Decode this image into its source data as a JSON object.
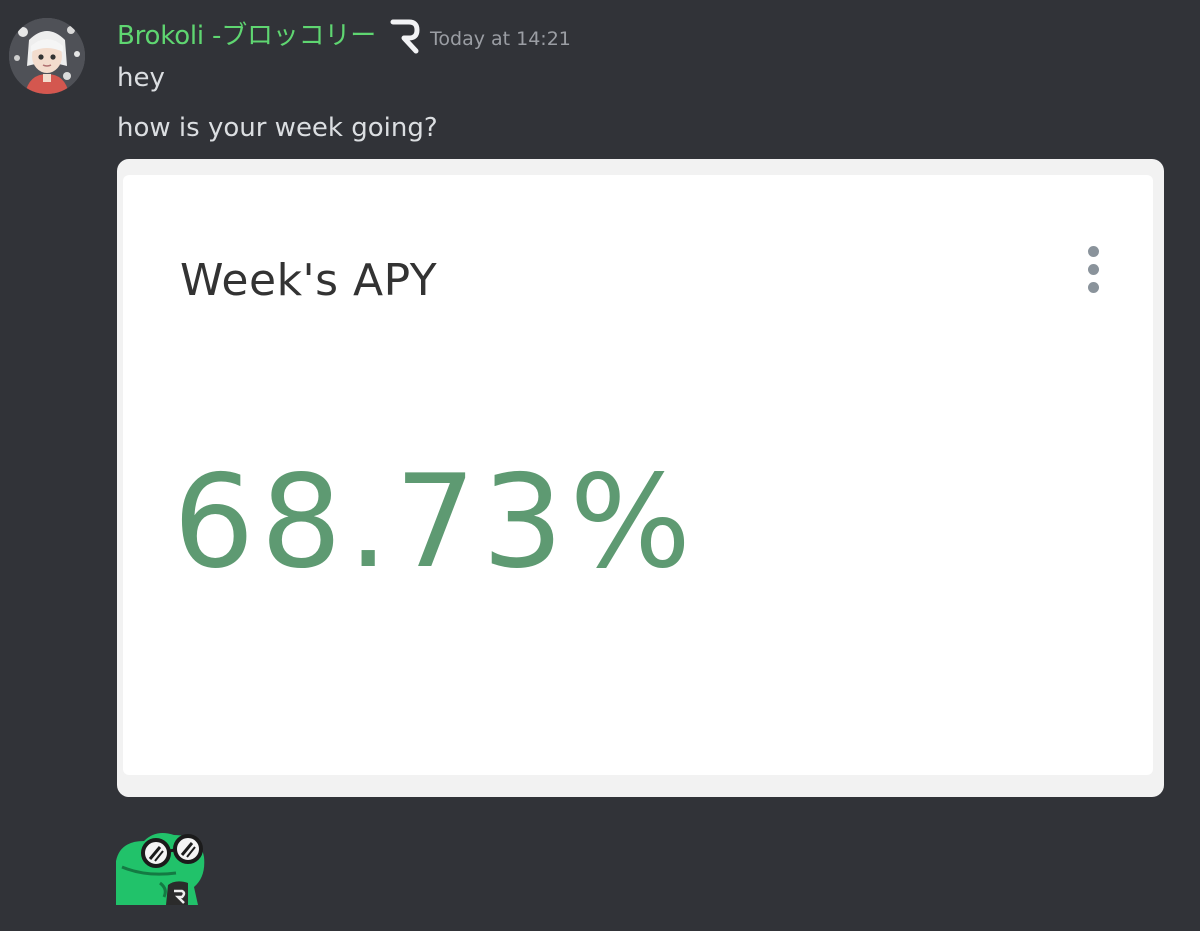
{
  "message": {
    "author": "Brokoli -ブロッコリー",
    "author_color": "#5fd671",
    "role_icon": "r-logo-icon",
    "timestamp": "Today at 14:21",
    "lines": [
      "hey",
      "how is your week going?"
    ]
  },
  "embed": {
    "title": "Week's APY",
    "value": "68.73%",
    "value_color": "#5e9a72",
    "menu_icon": "more-vertical-icon"
  },
  "sticker": {
    "icon": "frog-sunglasses-sticker"
  },
  "colors": {
    "background": "#313338",
    "message_text": "#dbdee1",
    "timestamp": "#9b9ea4"
  }
}
